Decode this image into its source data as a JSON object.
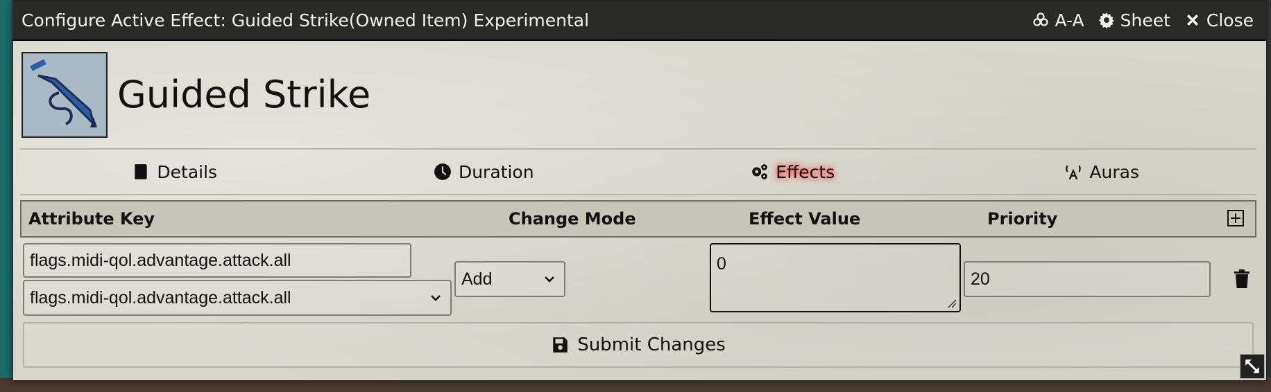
{
  "window": {
    "title": "Configure Active Effect: Guided Strike(Owned Item) Experimental",
    "actions": [
      {
        "label": "A-A",
        "icon": "biohazard-icon"
      },
      {
        "label": "Sheet",
        "icon": "gear-icon"
      },
      {
        "label": "Close",
        "icon": "close-icon"
      }
    ]
  },
  "item": {
    "name": "Guided Strike",
    "icon": "guided-strike-icon"
  },
  "tabs": [
    {
      "label": "Details",
      "icon": "book-icon"
    },
    {
      "label": "Duration",
      "icon": "clock-icon"
    },
    {
      "label": "Effects",
      "icon": "cogs-icon",
      "active": true
    },
    {
      "label": "Auras",
      "icon": "broadcast-icon"
    }
  ],
  "table": {
    "headers": {
      "attribute_key": "Attribute Key",
      "change_mode": "Change Mode",
      "effect_value": "Effect Value",
      "priority": "Priority"
    },
    "rows": [
      {
        "key_input": "flags.midi-qol.advantage.attack.all",
        "key_select": "flags.midi-qol.advantage.attack.all",
        "mode": "Add",
        "value": "0",
        "priority": "20"
      }
    ]
  },
  "submit_label": "Submit Changes",
  "colors": {
    "titlebar": "#2a2a28",
    "panel": "#d8d5cc",
    "active_glow": "#ff2d2d"
  }
}
